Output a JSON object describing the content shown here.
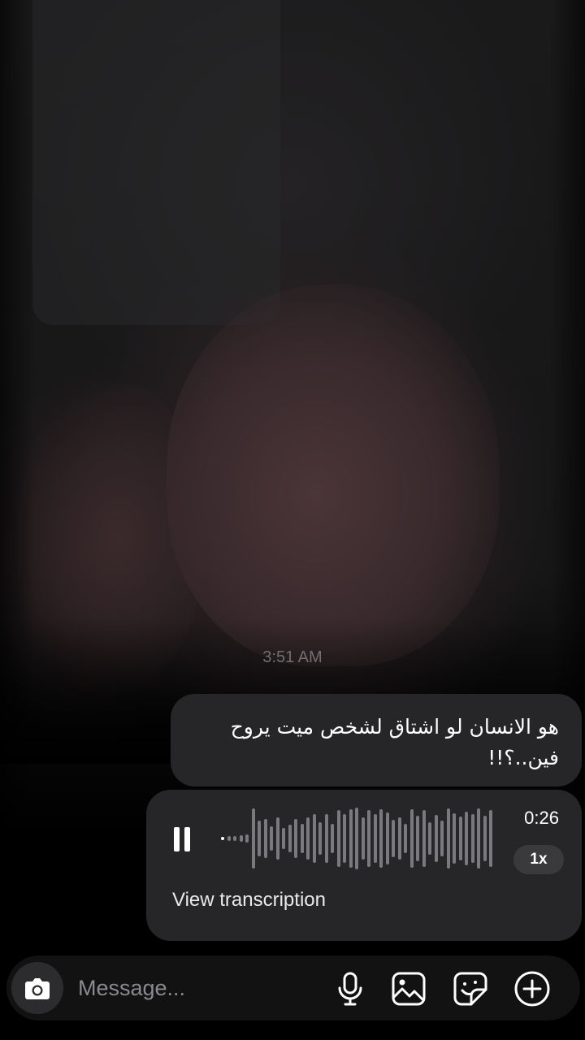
{
  "thread": {
    "timestamp": "3:51 AM",
    "messages": [
      {
        "type": "text",
        "text": "هو الانسان لو اشتاق لشخص ميت يروح فين..؟!!"
      },
      {
        "type": "voice",
        "duration": "0:26",
        "playback_speed": "1x",
        "transcription_link": "View transcription",
        "state": "playing",
        "progress": 0.02
      }
    ]
  },
  "composer": {
    "placeholder": "Message...",
    "icons": [
      "camera-icon",
      "microphone-icon",
      "gallery-icon",
      "sticker-icon",
      "add-icon"
    ]
  },
  "colors": {
    "bubble": "#262628",
    "waveform_unplayed": "#7a7a7e",
    "waveform_played": "#ffffff",
    "composer_bg": "#121213"
  }
}
